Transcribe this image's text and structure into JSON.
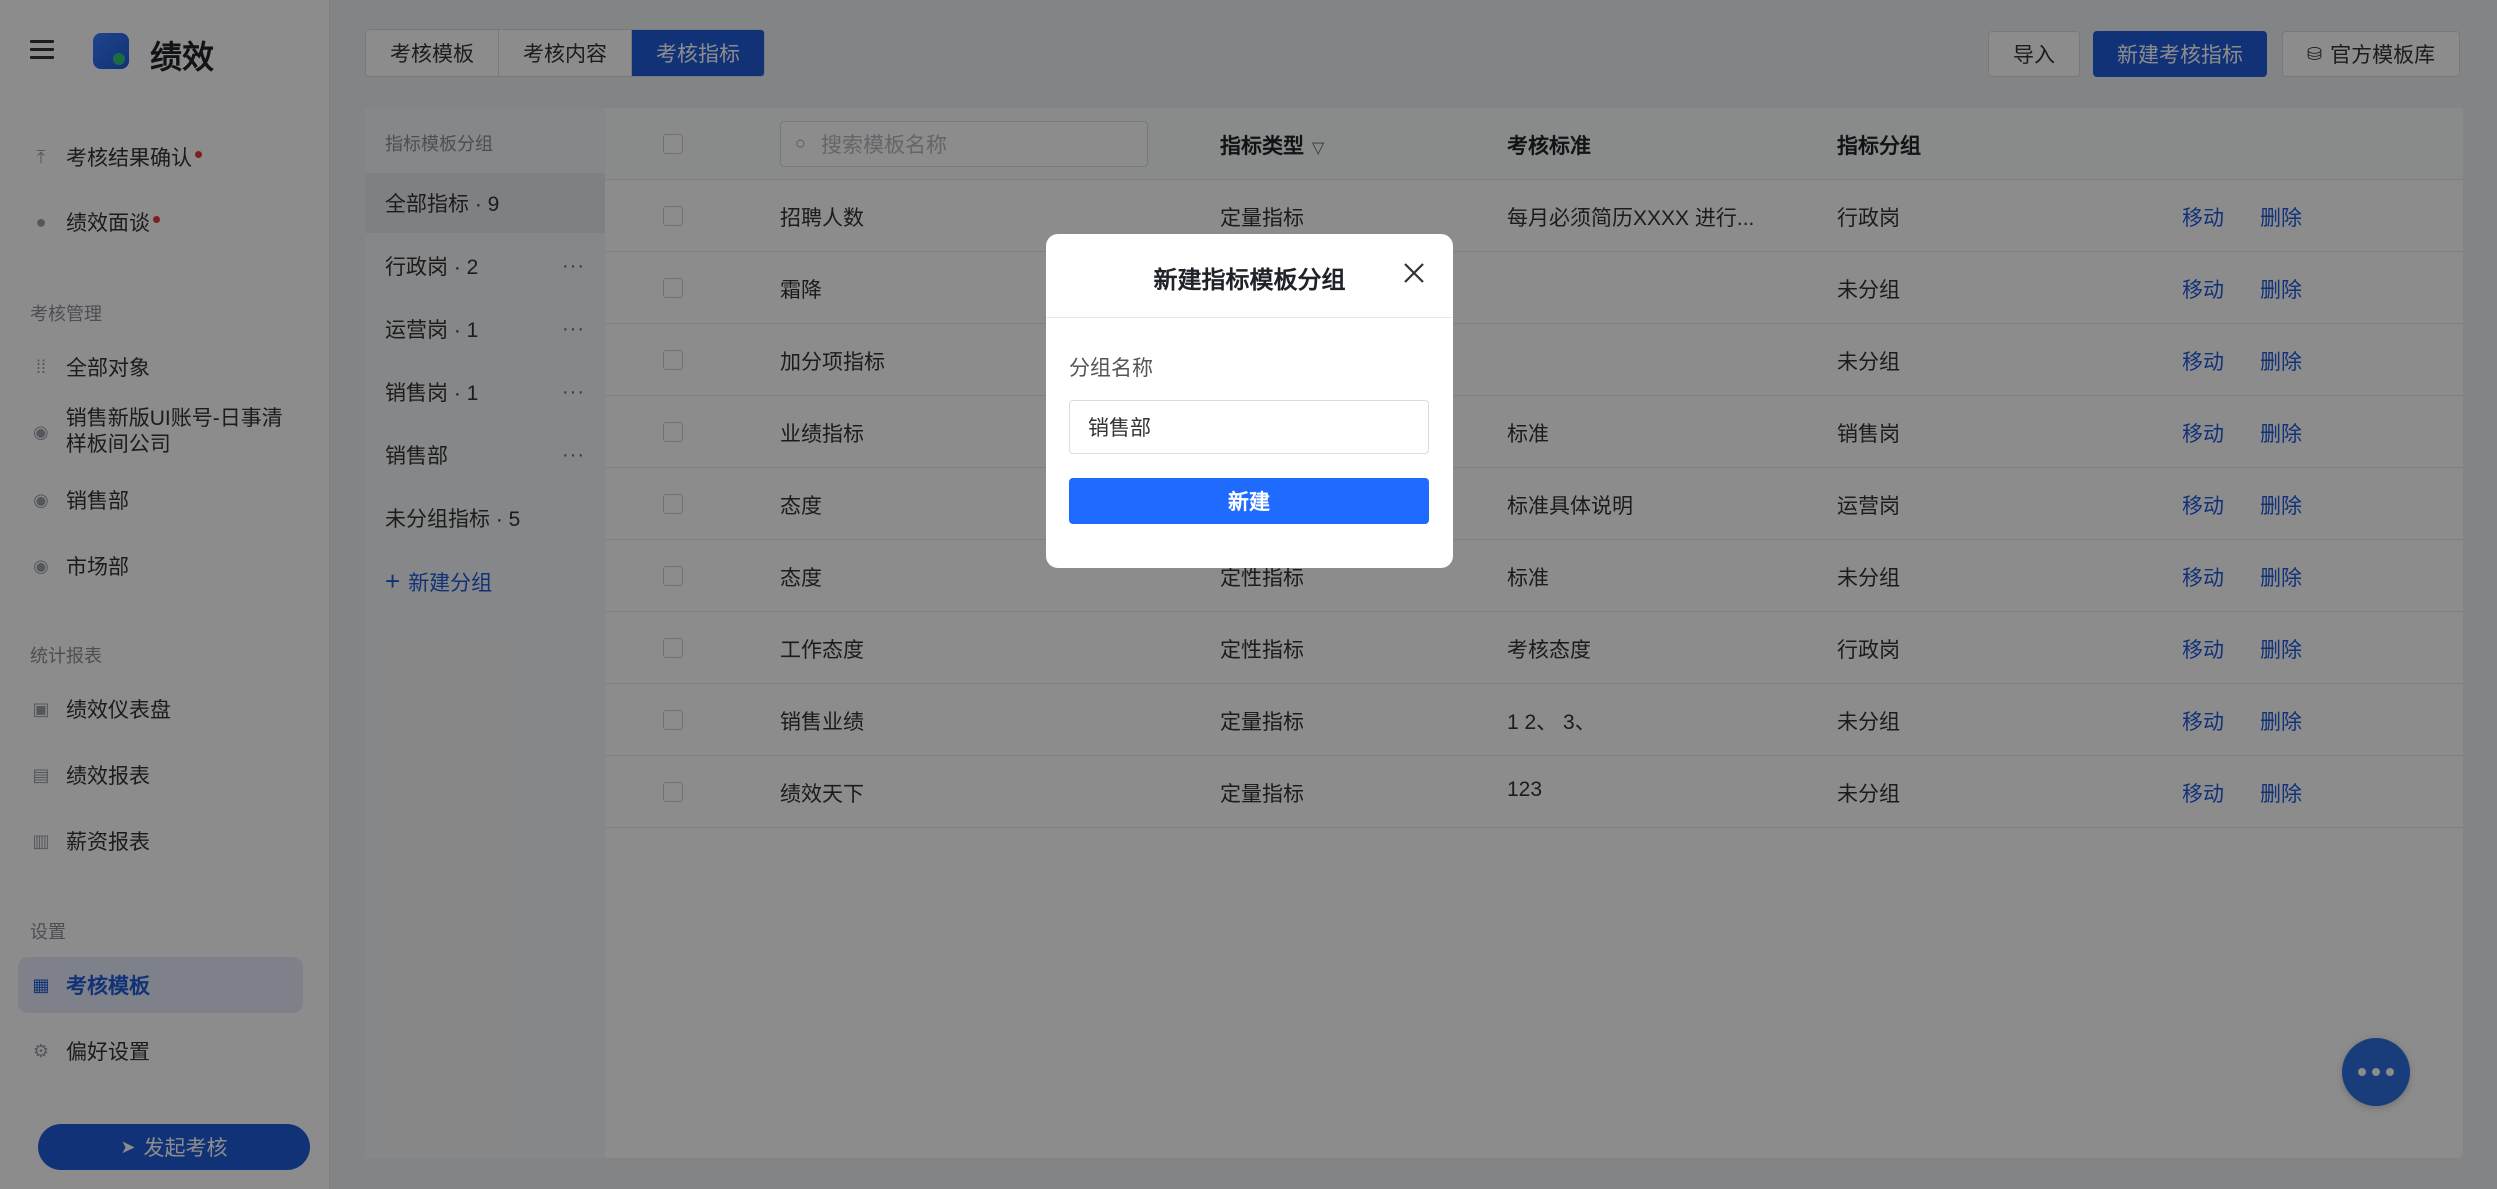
{
  "app": {
    "title": "绩效"
  },
  "sidebar": {
    "top_items": [
      {
        "label": "考核结果确认",
        "icon": "upload-icon",
        "has_dot": true
      },
      {
        "label": "绩效面谈",
        "icon": "chat-icon",
        "has_dot": true
      }
    ],
    "sections": [
      {
        "title": "考核管理",
        "items": [
          {
            "label": "全部对象",
            "icon": "grid-icon"
          },
          {
            "label": "销售新版UI账号-日事清样板间公司",
            "icon": "circle-icon"
          },
          {
            "label": "销售部",
            "icon": "circle-icon"
          },
          {
            "label": "市场部",
            "icon": "circle-icon"
          }
        ]
      },
      {
        "title": "统计报表",
        "items": [
          {
            "label": "绩效仪表盘",
            "icon": "dashboard-icon"
          },
          {
            "label": "绩效报表",
            "icon": "report-icon"
          },
          {
            "label": "薪资报表",
            "icon": "wallet-icon"
          }
        ]
      },
      {
        "title": "设置",
        "items": [
          {
            "label": "考核模板",
            "icon": "template-icon",
            "active": true
          },
          {
            "label": "偏好设置",
            "icon": "settings-icon"
          }
        ]
      }
    ],
    "launch_button": "发起考核"
  },
  "tabs": [
    "考核模板",
    "考核内容",
    "考核指标"
  ],
  "active_tab": "考核指标",
  "toolbar": {
    "import_label": "导入",
    "new_label": "新建考核指标",
    "library_label": "官方模板库"
  },
  "groups": {
    "header": "指标模板分组",
    "items": [
      {
        "label": "全部指标 · 9",
        "active": true,
        "has_more": false
      },
      {
        "label": "行政岗 · 2",
        "has_more": true
      },
      {
        "label": "运营岗 · 1",
        "has_more": true
      },
      {
        "label": "销售岗 · 1",
        "has_more": true
      },
      {
        "label": "销售部",
        "has_more": true
      },
      {
        "label": "未分组指标 · 5",
        "has_more": false
      }
    ],
    "more_glyph": "···",
    "add_label": "新建分组"
  },
  "table": {
    "search_placeholder": "搜索模板名称",
    "columns": {
      "type": "指标类型",
      "standard": "考核标准",
      "group": "指标分组"
    },
    "actions": {
      "move": "移动",
      "delete": "删除"
    },
    "rows": [
      {
        "name": "招聘人数",
        "type": "定量指标",
        "standard": "每月必须简历XXXX 进行...",
        "group": "行政岗"
      },
      {
        "name": "霜降",
        "type": "",
        "standard": "",
        "group": "未分组"
      },
      {
        "name": "加分项指标",
        "type": "",
        "standard": "",
        "group": "未分组"
      },
      {
        "name": "业绩指标",
        "type": "",
        "standard": "标准",
        "group": "销售岗"
      },
      {
        "name": "态度",
        "type": "",
        "standard": "标准具体说明",
        "group": "运营岗"
      },
      {
        "name": "态度",
        "type": "定性指标",
        "standard": "标准",
        "group": "未分组"
      },
      {
        "name": "工作态度",
        "type": "定性指标",
        "standard": "考核态度",
        "group": "行政岗"
      },
      {
        "name": "销售业绩",
        "type": "定量指标",
        "standard": "1 2、 3、",
        "group": "未分组"
      },
      {
        "name": "绩效天下",
        "type": "定量指标",
        "standard": "123",
        "group": "未分组"
      }
    ]
  },
  "modal": {
    "title": "新建指标模板分组",
    "field_label": "分组名称",
    "field_value": "销售部",
    "submit_label": "新建"
  },
  "colors": {
    "primary": "#1f5bd9",
    "modal_button": "#1f6bff",
    "overlay": "rgba(0,0,0,0.45)",
    "dot": "#e53935"
  }
}
